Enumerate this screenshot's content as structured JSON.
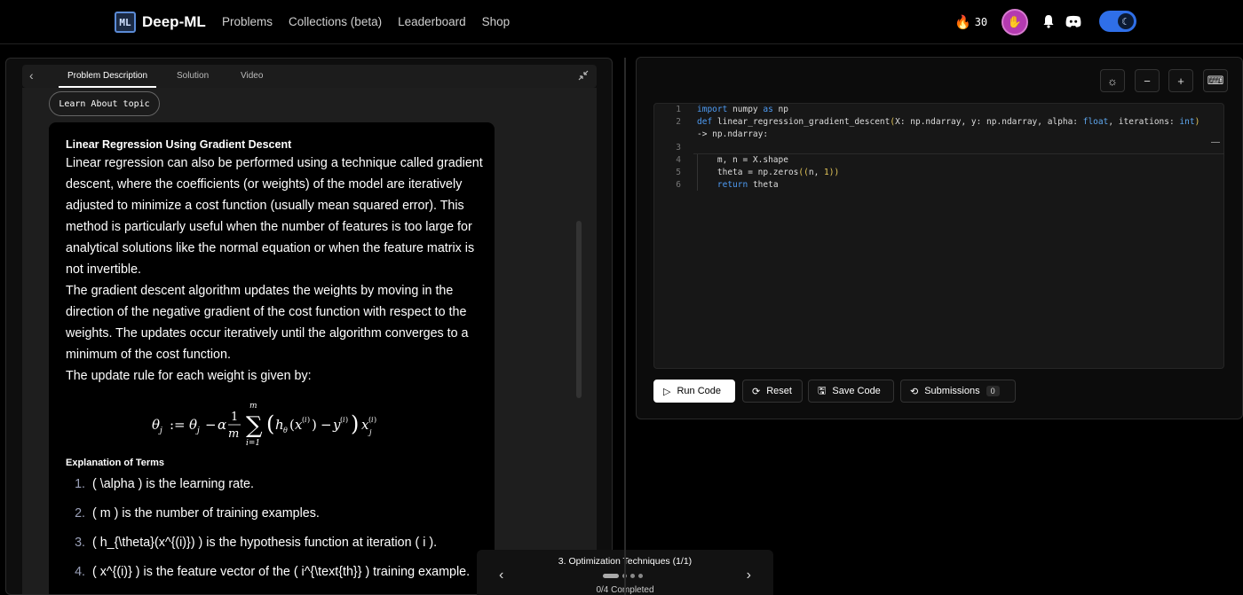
{
  "nav": {
    "brand": "Deep-ML",
    "logo_text": "ML",
    "links": [
      "Problems",
      "Collections (beta)",
      "Leaderboard",
      "Shop"
    ]
  },
  "user": {
    "streak": "30",
    "streak_icon": "flame-icon",
    "avatar_icon": "hamsa-icon"
  },
  "tabs": {
    "items": [
      "Problem Description",
      "Solution",
      "Video"
    ],
    "active": "Problem Description"
  },
  "learn_button": "Learn About topic",
  "problem": {
    "title": "Linear Regression Using Gradient Descent",
    "paragraphs": [
      "Linear regression can also be performed using a technique called gradient descent, where the coefficients (or weights) of the model are iteratively adjusted to minimize a cost function (usually mean squared error). This method is particularly useful when the number of features is too large for analytical solutions like the normal equation or when the feature matrix is not invertible.",
      "The gradient descent algorithm updates the weights by moving in the direction of the negative gradient of the cost function with respect to the weights. The updates occur iteratively until the algorithm converges to a minimum of the cost function.",
      "The update rule for each weight is given by:"
    ],
    "terms_heading": "Explanation of Terms",
    "terms": [
      {
        "num": "1.",
        "text": "( \\alpha ) is the learning rate."
      },
      {
        "num": "2.",
        "text": "( m ) is the number of training examples."
      },
      {
        "num": "3.",
        "text": "( h_{\\theta}(x^{(i)}) ) is the hypothesis function at iteration ( i )."
      },
      {
        "num": "4.",
        "text": "( x^{(i)} ) is the feature vector of the ( i^{\\text{th}} ) training example."
      }
    ]
  },
  "progress": {
    "title": "3. Optimization Techniques (1/1)",
    "completed": "0/4 Completed",
    "dots": 4,
    "active_dot": 0
  },
  "editor": {
    "line_numbers": [
      "1",
      "2",
      "",
      "3",
      "4",
      "5",
      "6"
    ]
  },
  "actions": {
    "run": "Run Code",
    "reset": "Reset",
    "save": "Save Code",
    "submissions": "Submissions",
    "submissions_count": "0"
  },
  "colors": {
    "accent_blue": "#2f6fe8",
    "keyword": "#4e9cf5",
    "number": "#e6c85a"
  }
}
